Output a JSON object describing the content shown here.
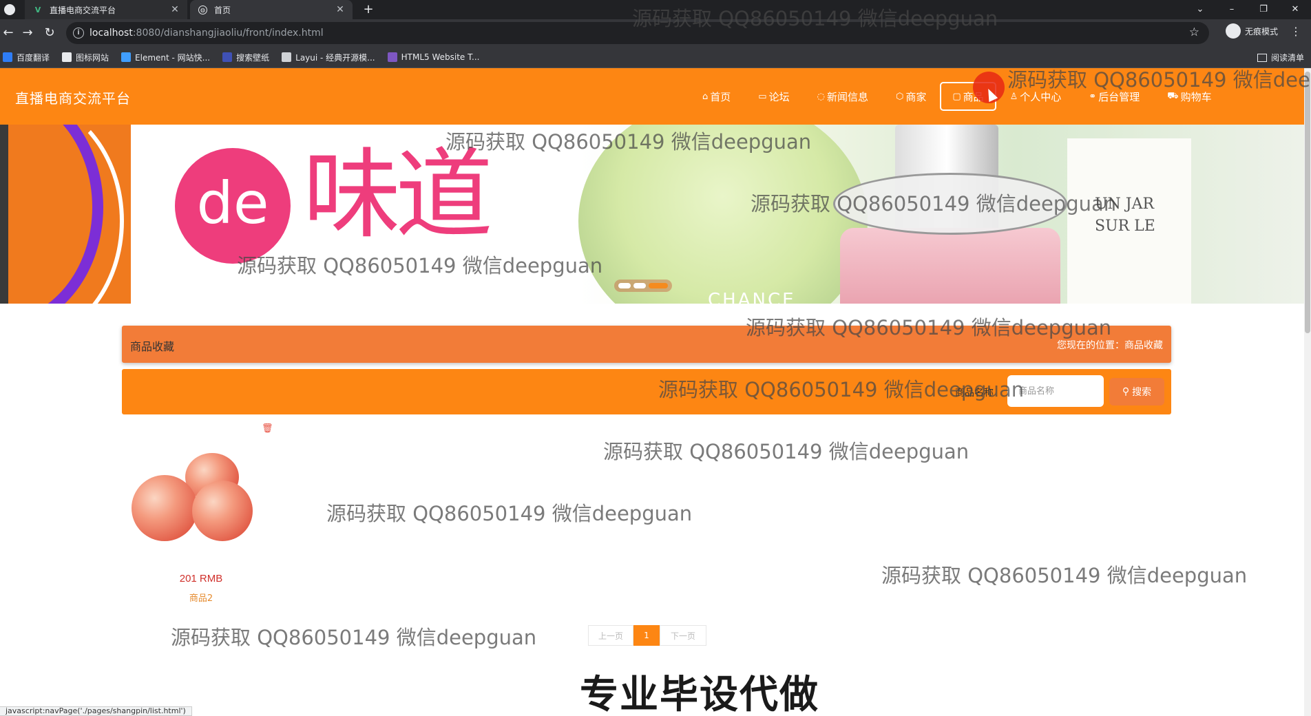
{
  "browser": {
    "tabs": [
      {
        "title": "直播电商交流平台",
        "icon": "vue-icon"
      },
      {
        "title": "首页",
        "icon": "globe-icon"
      }
    ],
    "url_host": "localhost",
    "url_path": ":8080/dianshangjiaoliu/front/index.html",
    "profile_label": "无痕模式",
    "bookmarks": [
      "百度翻译",
      "图标网站",
      "Element - 网站快...",
      "搜索壁纸",
      "Layui - 经典开源模...",
      "HTML5 Website T..."
    ],
    "reading_list": "阅读清单"
  },
  "header": {
    "site_title": "直播电商交流平台",
    "nav": [
      {
        "label": "首页",
        "icon": "home-icon"
      },
      {
        "label": "论坛",
        "icon": "forum-icon"
      },
      {
        "label": "新闻信息",
        "icon": "news-icon"
      },
      {
        "label": "商家",
        "icon": "shop-icon"
      },
      {
        "label": "商品",
        "icon": "goods-icon",
        "active": true
      },
      {
        "label": "个人中心",
        "icon": "user-icon"
      },
      {
        "label": "后台管理",
        "icon": "link-icon"
      },
      {
        "label": "购物车",
        "icon": "cart-icon"
      }
    ]
  },
  "banner": {
    "logo_text": "de",
    "brand_text": "味道",
    "right_text_line1": "UN JAR",
    "right_text_line2": "SUR LE",
    "bottle_text": "CHANCE",
    "carousel": {
      "count": 3,
      "active_index": 2
    }
  },
  "breadcrumb": {
    "title": "商品收藏",
    "location": "您现在的位置：商品收藏"
  },
  "search": {
    "label": "商品名称",
    "placeholder": "商品名称",
    "button_label": "搜索"
  },
  "products": [
    {
      "price": "201 RMB",
      "name": "商品2",
      "image": "apples"
    }
  ],
  "pagination": {
    "prev_label": "上一页",
    "current_page": "1",
    "next_label": "下一页"
  },
  "overlay": {
    "watermark": "源码获取 QQ86050149 微信deepguan",
    "caption": "专业毕设代做",
    "status_url": "javascript:navPage('./pages/shangpin/list.html')"
  },
  "colors": {
    "header_orange": "#fd8613",
    "breadcrumb_orange": "#f27c38",
    "price_red": "#d0302b",
    "brand_pink": "#ee3d7c"
  }
}
